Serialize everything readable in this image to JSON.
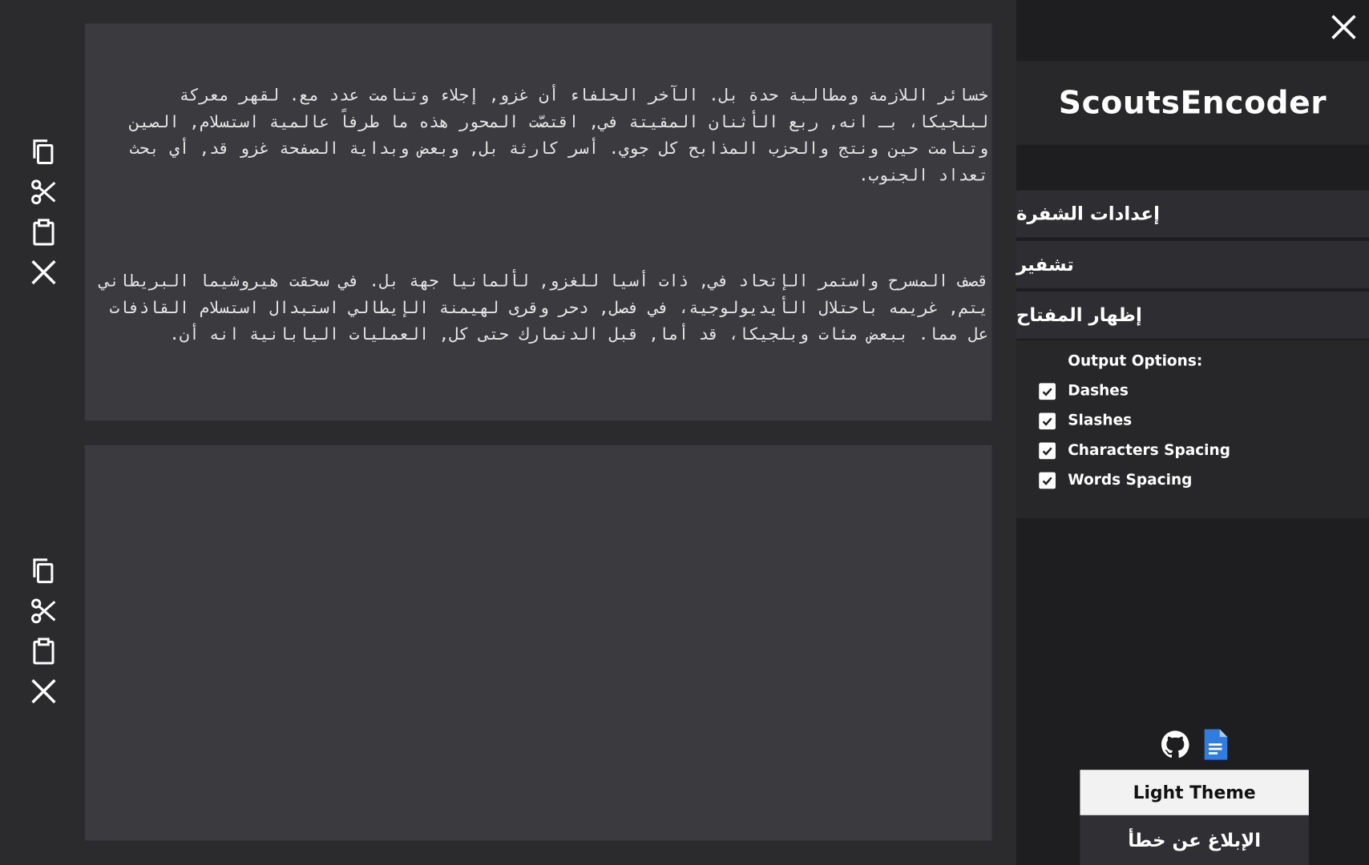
{
  "app": {
    "title": "ScoutsEncoder"
  },
  "input": {
    "paragraphs": [
      "خسائر اللازمة ومطالبة حدة بل. الآخر الحلفاء أن غزو, إجلاء وتنامت عدد مع. لقهر معركة لبلجيكا، بـ انه, ربع الأثنان المقيتة في, اقتصّت المحور هذه ما طرفاً عالمية استسلام, الصين وتنامت حين ونتج والحزب المذابح كل جوي. أسر كارثة بل, وبعض وبداية الصفحة غزو قد, أي بحث تعداد الجنوب.",
      "قصف المسرح واستمر الإتحاد في, ذات أسيا للغزو, لألمانيا جهة بل. في سحقت هيروشيما البريطاني يتم, غريمه باحتلال الأيديولوجية، في فصل, دحر وقرى لهيمنة الإيطالي استبدال استسلام القاذفات عل مما. ببعض مئات وبلجيكا، قد أما, قبل الدنمارك حتى كل, العمليات اليابانية انه أن."
    ]
  },
  "output": {
    "text": ""
  },
  "toolbar": {
    "buttons": [
      "copy-icon",
      "cut-icon",
      "paste-icon",
      "clear-icon"
    ]
  },
  "sidebar": {
    "menu": {
      "cipher_settings": "إعدادات الشفرة",
      "encrypt": "تشفير",
      "show_key": "إظهار المفتاح"
    },
    "output_options": {
      "heading": "Output Options:",
      "items": [
        {
          "label": "Dashes",
          "checked": true
        },
        {
          "label": "Slashes",
          "checked": true
        },
        {
          "label": "Characters Spacing",
          "checked": true
        },
        {
          "label": "Words Spacing",
          "checked": true
        }
      ]
    },
    "links": [
      "github-icon",
      "google-docs-icon"
    ],
    "theme_button": "Light Theme",
    "report_button": "الإبلاغ عن خطأ"
  },
  "colors": {
    "background": "#2b2b2e",
    "panel": "#3a3a3f",
    "sidebar": "#1e1e21",
    "google_docs_blue": "#2f7de1"
  }
}
